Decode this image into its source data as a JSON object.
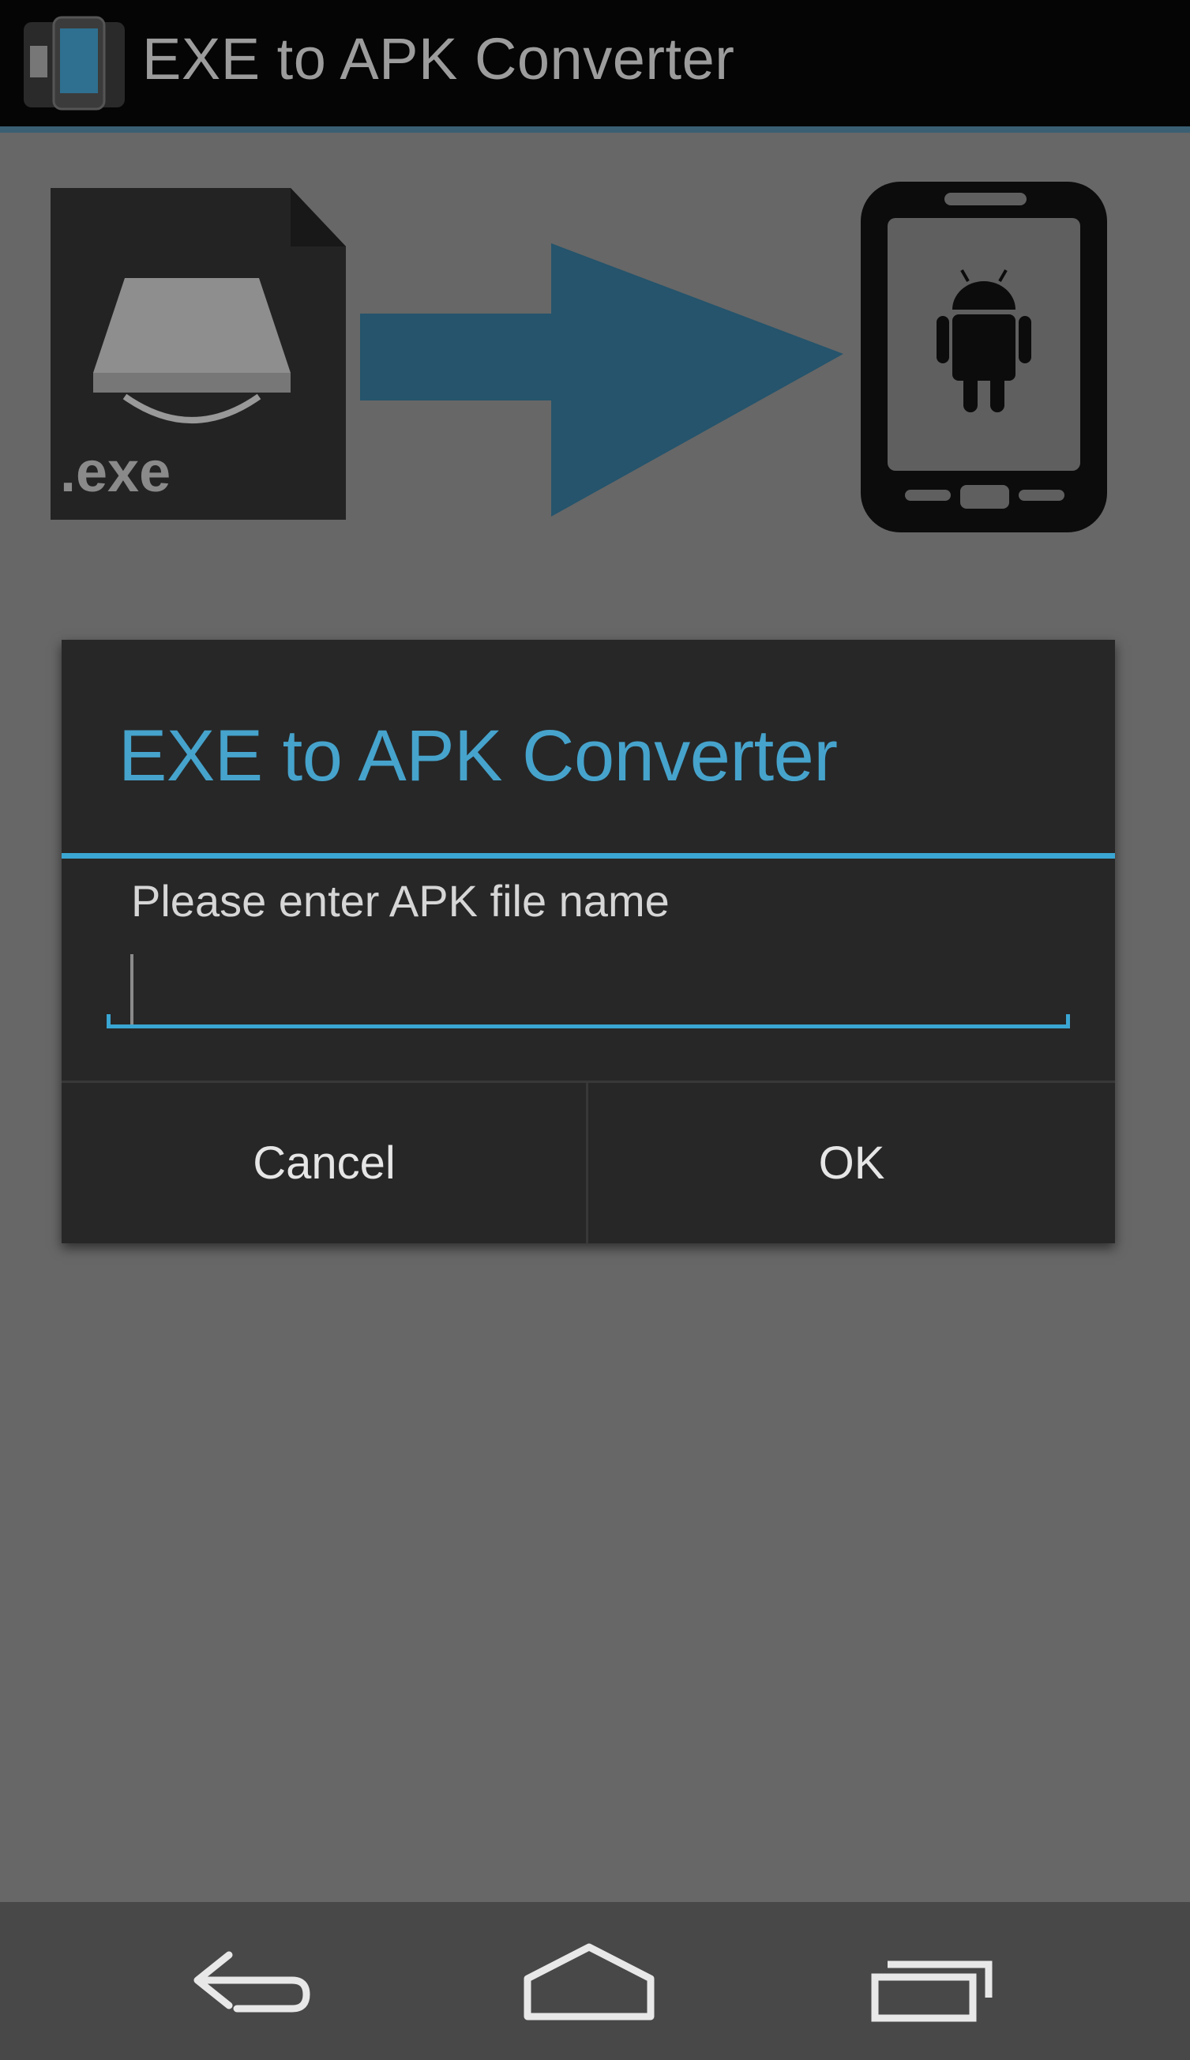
{
  "app": {
    "title": "EXE to APK Converter"
  },
  "banner": {
    "file_label": ".exe"
  },
  "dialog": {
    "title": "EXE to APK Converter",
    "prompt": "Please enter APK file name",
    "input_value": "",
    "cancel_label": "Cancel",
    "ok_label": "OK"
  },
  "colors": {
    "accent": "#3aa6d3",
    "dialog_bg": "#272727",
    "scrim": "#676767",
    "actionbar_bg": "#050505",
    "navbar_bg": "#484848"
  },
  "navbar": {
    "buttons": [
      "back-icon",
      "home-icon",
      "recent-apps-icon"
    ]
  }
}
